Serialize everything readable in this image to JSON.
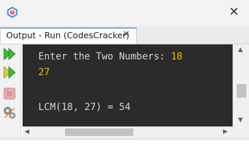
{
  "window": {
    "close_glyph": "✕"
  },
  "tab": {
    "label": "Output - Run (CodesCracker)",
    "close_glyph": "✕"
  },
  "console": {
    "line1_prompt": "Enter the Two Numbers: ",
    "line1_input": "18",
    "line2_input": "27",
    "line3": "",
    "line4": "LCM(18, 27) = 54",
    "text_color": "#d4d4d4",
    "input_color": "#e5c100",
    "background": "#2b2b2b"
  },
  "toolbar": {
    "items": [
      {
        "icon": "rerun-icon"
      },
      {
        "icon": "rerun-with-options-icon"
      },
      {
        "icon": "stop-icon"
      },
      {
        "icon": "settings-icon"
      }
    ]
  },
  "scroll": {
    "up": "▲",
    "down": "▼",
    "left": "◀",
    "right": "▶"
  }
}
